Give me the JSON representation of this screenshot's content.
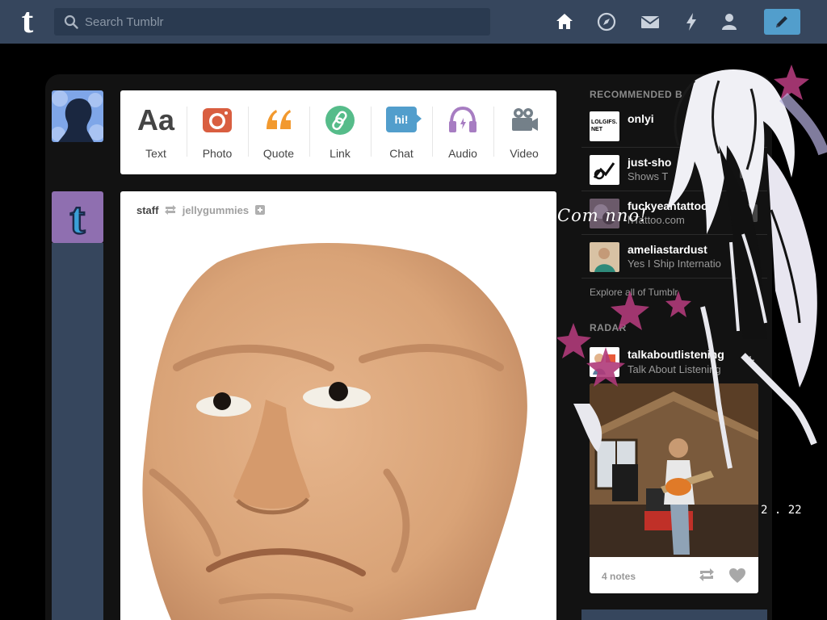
{
  "header": {
    "search_placeholder": "Search Tumblr",
    "logo_letter": "t"
  },
  "post_types": [
    {
      "label": "Text",
      "glyph": "Aa",
      "color": "#444444"
    },
    {
      "label": "Photo",
      "color": "#d95e40"
    },
    {
      "label": "Quote",
      "glyph": "“",
      "color": "#f2992e"
    },
    {
      "label": "Link",
      "color": "#56bc8a"
    },
    {
      "label": "Chat",
      "glyph": "hi!",
      "color": "#529ecc"
    },
    {
      "label": "Audio",
      "color": "#a77dc2"
    },
    {
      "label": "Video",
      "color": "#748089"
    }
  ],
  "post": {
    "author": "staff",
    "reblogged_from": "jellygummies"
  },
  "sidebar": {
    "recommended_heading": "RECOMMENDED B",
    "recommended": [
      {
        "name": "onlyi",
        "subtitle": "",
        "thumb_text": "LOLGIFS. NET"
      },
      {
        "name": "just-sho",
        "subtitle": "Shows T"
      },
      {
        "name": "fuckyeahtattoos",
        "subtitle": "hTattoo.com"
      },
      {
        "name": "ameliastardust",
        "subtitle": "Yes I Ship Internatio"
      }
    ],
    "explore_label": "Explore all of Tumblr",
    "radar_heading": "RADAR",
    "radar": {
      "name": "talkaboutlistening",
      "subtitle": "Talk About Listening",
      "notes": "4 notes"
    }
  },
  "decoration": {
    "script_text": "Com nno!",
    "number_text": "2 . 22"
  },
  "colors": {
    "header": "#36465d",
    "accent": "#529ecc",
    "panel": "#121212"
  }
}
